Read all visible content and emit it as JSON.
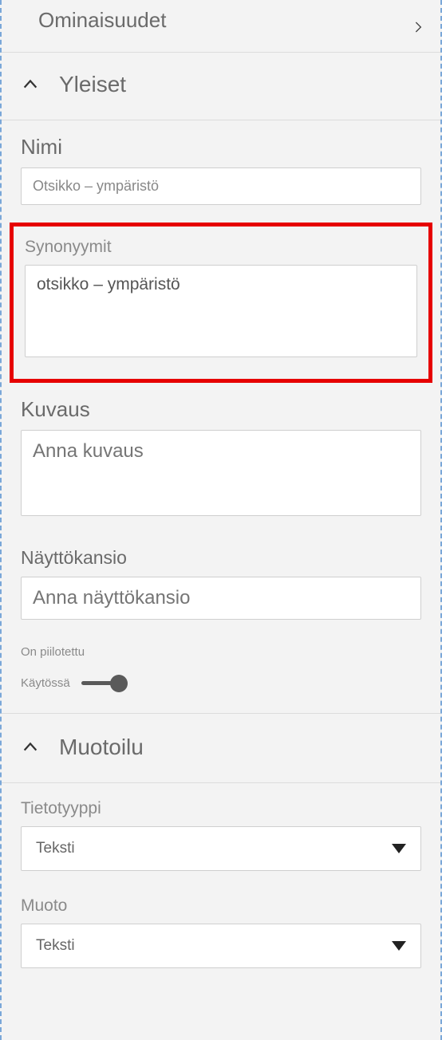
{
  "top": {
    "title": "Ominaisuudet"
  },
  "general": {
    "header": "Yleiset",
    "name_label": "Nimi",
    "name_value": "Otsikko – ympäristö",
    "synonyms_label": "Synonyymit",
    "synonyms_value": "otsikko – ympäristö",
    "description_label": "Kuvaus",
    "description_placeholder": "Anna kuvaus",
    "folder_label": "Näyttökansio",
    "folder_placeholder": "Anna näyttökansio",
    "hidden_label": "On piilotettu",
    "toggle_label": "Käytössä"
  },
  "formatting": {
    "header": "Muotoilu",
    "datatype_label": "Tietotyyppi",
    "datatype_value": "Teksti",
    "format_label": "Muoto",
    "format_value": "Teksti"
  }
}
